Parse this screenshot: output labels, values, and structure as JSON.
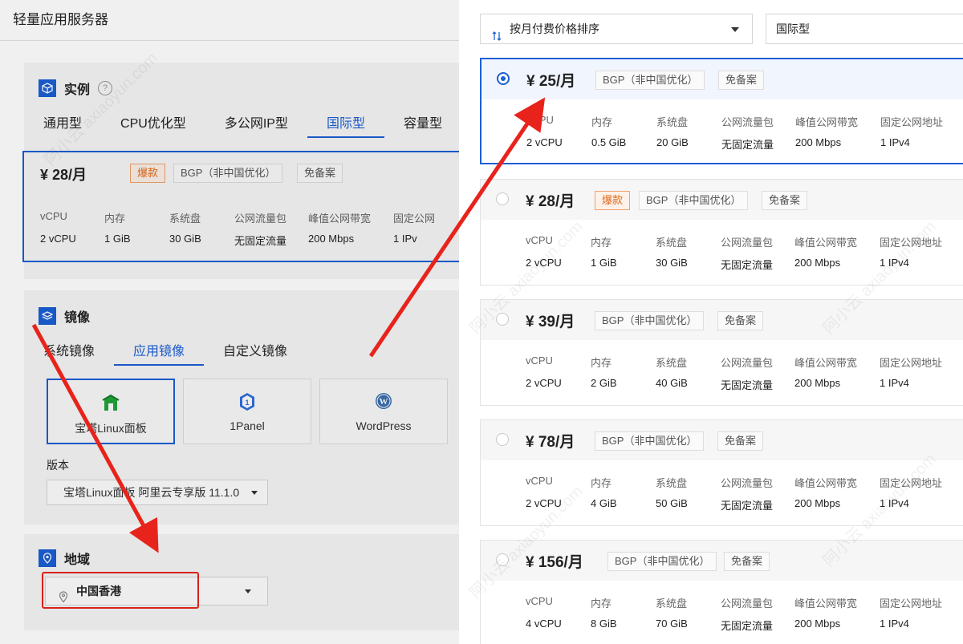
{
  "page_title": "轻量应用服务器",
  "instance": {
    "heading": "实例",
    "help": "?",
    "tabs": [
      "通用型",
      "CPU优化型",
      "多公网IP型",
      "国际型",
      "容量型"
    ],
    "active_tab": 3,
    "selected": {
      "price": "¥ 28/月",
      "hot": "爆款",
      "line": "BGP（非中国优化）",
      "icp": "免备案",
      "spec_headers": [
        "vCPU",
        "内存",
        "系统盘",
        "公网流量包",
        "峰值公网带宽",
        "固定公网"
      ],
      "spec_values": [
        "2 vCPU",
        "1 GiB",
        "30 GiB",
        "无固定流量",
        "200 Mbps",
        "1 IPv"
      ]
    }
  },
  "image": {
    "heading": "镜像",
    "tabs": [
      "系统镜像",
      "应用镜像",
      "自定义镜像"
    ],
    "active_tab": 1,
    "cards": [
      "宝塔Linux面板",
      "1Panel",
      "WordPress"
    ],
    "version_label": "版本",
    "version_value": "宝塔Linux面板 阿里云专享版 11.1.0"
  },
  "region": {
    "heading": "地域",
    "value": "中国香港"
  },
  "sort": {
    "label": "按月付费价格排序",
    "type_filter": "国际型"
  },
  "plans": [
    {
      "price": "¥ 25/月",
      "hot": "",
      "line": "BGP（非中国优化）",
      "icp": "免备案",
      "selected": true,
      "values": [
        "2 vCPU",
        "0.5 GiB",
        "20 GiB",
        "无固定流量",
        "200 Mbps",
        "1 IPv4"
      ]
    },
    {
      "price": "¥ 28/月",
      "hot": "爆款",
      "line": "BGP（非中国优化）",
      "icp": "免备案",
      "selected": false,
      "values": [
        "2 vCPU",
        "1 GiB",
        "30 GiB",
        "无固定流量",
        "200 Mbps",
        "1 IPv4"
      ]
    },
    {
      "price": "¥ 39/月",
      "hot": "",
      "line": "BGP（非中国优化）",
      "icp": "免备案",
      "selected": false,
      "values": [
        "2 vCPU",
        "2 GiB",
        "40 GiB",
        "无固定流量",
        "200 Mbps",
        "1 IPv4"
      ]
    },
    {
      "price": "¥ 78/月",
      "hot": "",
      "line": "BGP（非中国优化）",
      "icp": "免备案",
      "selected": false,
      "values": [
        "2 vCPU",
        "4 GiB",
        "50 GiB",
        "无固定流量",
        "200 Mbps",
        "1 IPv4"
      ]
    },
    {
      "price": "¥ 156/月",
      "hot": "",
      "line": "BGP（非中国优化）",
      "icp": "免备案",
      "selected": false,
      "values": [
        "4 vCPU",
        "8 GiB",
        "70 GiB",
        "无固定流量",
        "200 Mbps",
        "1 IPv4"
      ]
    }
  ],
  "plan_spec_headers": [
    "vCPU",
    "内存",
    "系统盘",
    "公网流量包",
    "峰值公网带宽",
    "固定公网地址"
  ],
  "watermark": "阿小云 axiaoyun.com",
  "colors": {
    "accent": "#1b5fd6",
    "annotation": "#e8231b",
    "hot": "#e06a1c"
  }
}
